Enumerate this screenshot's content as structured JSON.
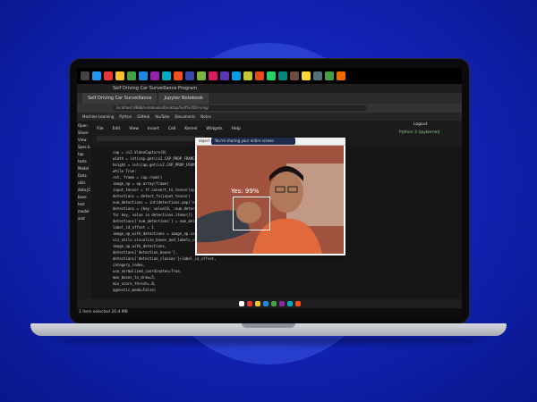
{
  "browser": {
    "title": "Self Driving Car Surveillance Program",
    "tabs": [
      "Self Driving Car Surveillance",
      "Jupyter Notebook"
    ],
    "address": "localhost:8888/notebooks/Desktop/Self%20Driving/"
  },
  "bookmarks": [
    "Machine Learning",
    "Python",
    "GitHub",
    "YouTube",
    "Documents",
    "Notes"
  ],
  "sidebar_items": [
    "Open",
    "Share",
    "View",
    "Spec.b",
    "top",
    "tests",
    "Model",
    "Data",
    "utils",
    "data.JC",
    "base",
    "test",
    "model",
    "and"
  ],
  "jupyter": {
    "menu": [
      "File",
      "Edit",
      "View",
      "Insert",
      "Cell",
      "Kernel",
      "Widgets",
      "Help"
    ],
    "logout": "Logout",
    "kernel": "Python 3 (ipykernel)",
    "code": [
      "cap = cv2.VideoCapture(0)",
      "width = int(cap.get(cv2.CAP_PROP_FRAME_WIDTH))",
      "height = int(cap.get(cv2.CAP_PROP_FRAME_HEIGHT))",
      "while True:",
      "    ret, frame = cap.read()",
      "    image_np = np.array(frame)",
      "    input_tensor = tf.convert_to_tensor(np.expand_dims(image_np, 0))",
      "    detections = detect_fn(input_tensor)",
      "    num_detections = int(detections.pop('num_detections'))",
      "    detections = {key: value[0, :num_detections].numpy()",
      "                  for key, value in detections.items()}",
      "    detections['num_detections'] = num_detections",
      "    label_id_offset = 1",
      "    image_np_with_detections = image_np.copy()",
      "    viz_utils.visualize_boxes_and_labels_on_image_array(",
      "                image_np_with_detections,",
      "                detections['detection_boxes'],",
      "                detections['detection_classes']+label_id_offset,",
      "                category_index,",
      "                use_normalized_coordinates=True,",
      "                max_boxes_to_draw=5,",
      "                min_score_thresh=.8,",
      "                agnostic_mode=False)"
    ]
  },
  "webcam": {
    "title": "object detection",
    "share_text": "You're sharing your entire screen",
    "detection_label": "Yes: 99%"
  },
  "status_bar": "1 item selected  20.4 MB",
  "colors": {
    "accent": "#1224b8"
  }
}
